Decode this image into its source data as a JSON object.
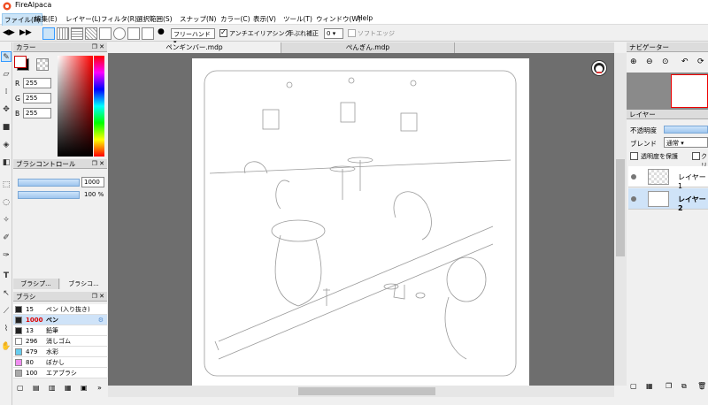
{
  "window": {
    "title": "FireAlpaca"
  },
  "menu": [
    "ファイル(F)",
    "編集(E)",
    "レイヤー(L)",
    "フィルタ(R)",
    "選択範囲(S)",
    "スナップ(N)",
    "カラー(C)",
    "表示(V)",
    "ツール(T)",
    "ウィンドウ(W)",
    "Help"
  ],
  "toolbar": {
    "mode_label": "フリーハンド",
    "antialias_label": "アンチエイリアシング",
    "stabilizer_label": "手ぶれ補正",
    "stabilizer_value": "0",
    "soft_edge_label": "ソフトエッジ"
  },
  "color_panel": {
    "title": "カラー",
    "r_label": "R",
    "r": "255",
    "g_label": "G",
    "g": "255",
    "b_label": "B",
    "b": "255",
    "foreground_color": "#ffffff",
    "background_color": "#000000"
  },
  "brush_control": {
    "title": "ブラシコントロール",
    "size": "1000",
    "size_fill": 1.0,
    "opacity": "100 %",
    "opacity_fill": 1.0
  },
  "brush_tabs": [
    "ブラシプ...",
    "ブラシコ..."
  ],
  "brush_panel": {
    "title": "ブラシ",
    "items": [
      {
        "num": "15",
        "name": "ペン (入り抜き)",
        "color": "#222222",
        "selected": false
      },
      {
        "num": "1000",
        "name": "ペン",
        "color": "#222222",
        "selected": true
      },
      {
        "num": "13",
        "name": "鉛筆",
        "color": "#222222",
        "selected": false
      },
      {
        "num": "296",
        "name": "消しゴム",
        "color": "#ffffff",
        "selected": false
      },
      {
        "num": "479",
        "name": "水彩",
        "color": "#66ccee",
        "selected": false
      },
      {
        "num": "80",
        "name": "ぼかし",
        "color": "#f08ef0",
        "selected": false
      },
      {
        "num": "100",
        "name": "エアブラシ",
        "color": "#aaaaaa",
        "selected": false
      }
    ]
  },
  "tabs": [
    {
      "label": "ペンギンバー.mdp",
      "active": true
    },
    {
      "label": "ぺんぎん.mdp",
      "active": false
    }
  ],
  "navigator": {
    "title": "ナビゲーター"
  },
  "layer_panel": {
    "title": "レイヤー",
    "opacity_label": "不透明度",
    "blend_label": "ブレンド",
    "blend_value": "通常",
    "protect_alpha_label": "透明度を保護",
    "clipping_label": "クリッ",
    "layers": [
      {
        "name": "レイヤー1",
        "selected": false
      },
      {
        "name": "レイヤー2",
        "selected": true
      }
    ]
  },
  "colors": {
    "accent": "#3399ff",
    "canvas_bg": "#6e6e6e"
  }
}
